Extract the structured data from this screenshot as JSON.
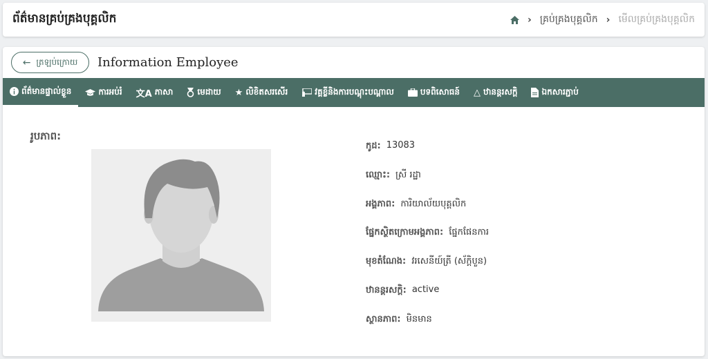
{
  "header": {
    "title": "ព័ត៌មានគ្រប់គ្រងបុគ្គលិក",
    "breadcrumb": {
      "home_icon": "home-icon",
      "link": "គ្រប់គ្រងបុគ្គលិក",
      "current": "មើលគ្រប់គ្រងបុគ្គលិក"
    }
  },
  "main": {
    "back_label": "ត្រឡប់ក្រោយ",
    "title": "Information Employee",
    "tabs": [
      {
        "label": "ព័ត៌មានផ្ទាល់ខ្លួន",
        "icon": "info-icon",
        "glyph": "ⓘ"
      },
      {
        "label": "ការអប់រំ",
        "icon": "graduation-cap-icon",
        "glyph": "🎓"
      },
      {
        "label": "ភាសា",
        "icon": "translate-icon",
        "glyph": "文"
      },
      {
        "label": "មេដាយ",
        "icon": "medal-icon",
        "glyph": "🏅"
      },
      {
        "label": "លិខិតសរសើរ",
        "icon": "star-icon",
        "glyph": "★"
      },
      {
        "label": "វគ្គខ្លីនិងការបណ្តុះបណ្តាល",
        "icon": "training-icon",
        "glyph": "▣"
      },
      {
        "label": "បទពិសោធន៍",
        "icon": "briefcase-icon",
        "glyph": "■"
      },
      {
        "label": "ឋានន្តរសក្តិ",
        "icon": "triangle-icon",
        "glyph": "△"
      },
      {
        "label": "ឯកសារភ្ជាប់",
        "icon": "file-icon",
        "glyph": "▤"
      }
    ],
    "photo_label": "រូបភាព:",
    "fields": [
      {
        "key": "កូដ:",
        "value": "13083"
      },
      {
        "key": "ឈ្មោះ:",
        "value": "ស្រី រដ្ឋា"
      },
      {
        "key": "អង្គភាព:",
        "value": "ការិយាល័យបុគ្គលិក"
      },
      {
        "key": "ផ្នែកស្ថិតក្រោមអង្គភាព:",
        "value": "ផ្នែកផែនការ"
      },
      {
        "key": "មុខតំណែង:",
        "value": "វរសេនីយ៍ត្រី (ស័ក្តិបួន)"
      },
      {
        "key": "ឋានន្តរសក្តិ:",
        "value": "active"
      },
      {
        "key": "ស្ថានភាព:",
        "value": "មិនមាន"
      }
    ]
  },
  "colors": {
    "accent": "#4b6e66",
    "background": "#eef0f2"
  }
}
